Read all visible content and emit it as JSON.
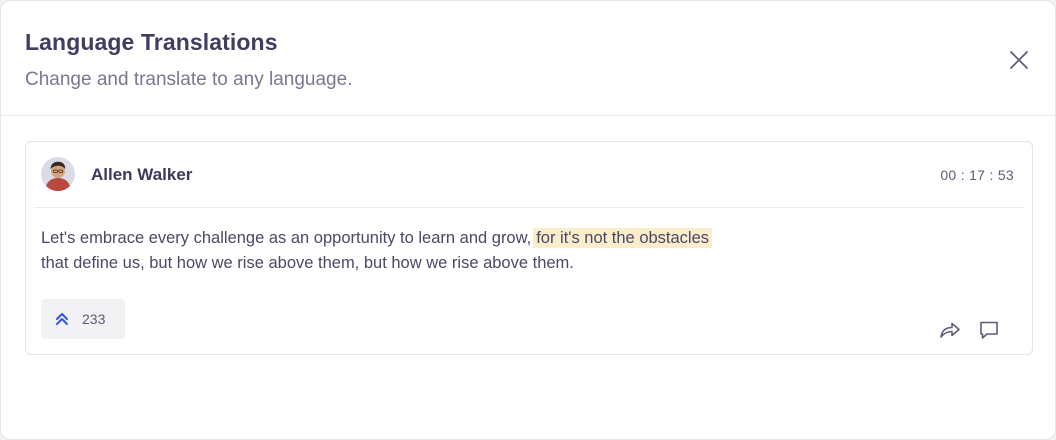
{
  "modal": {
    "title": "Language Translations",
    "subtitle": "Change and translate to any language."
  },
  "post": {
    "author": "Allen Walker",
    "timestamp": "00 : 17 : 53",
    "text_before": "Let's embrace every challenge as an opportunity to learn and grow,",
    "text_highlight": "for it's not the obstacles",
    "text_after": "that define us, but how we rise above them, but how we rise above them.",
    "upvote_count": "233"
  },
  "icons": {
    "close": "close-icon",
    "upvote": "double-chevron-up-icon",
    "share": "share-icon",
    "comment": "comment-icon"
  },
  "colors": {
    "title": "#3f3d62",
    "subtitle": "#797891",
    "highlight": "#fbeccb",
    "accent": "#2f54eb"
  }
}
